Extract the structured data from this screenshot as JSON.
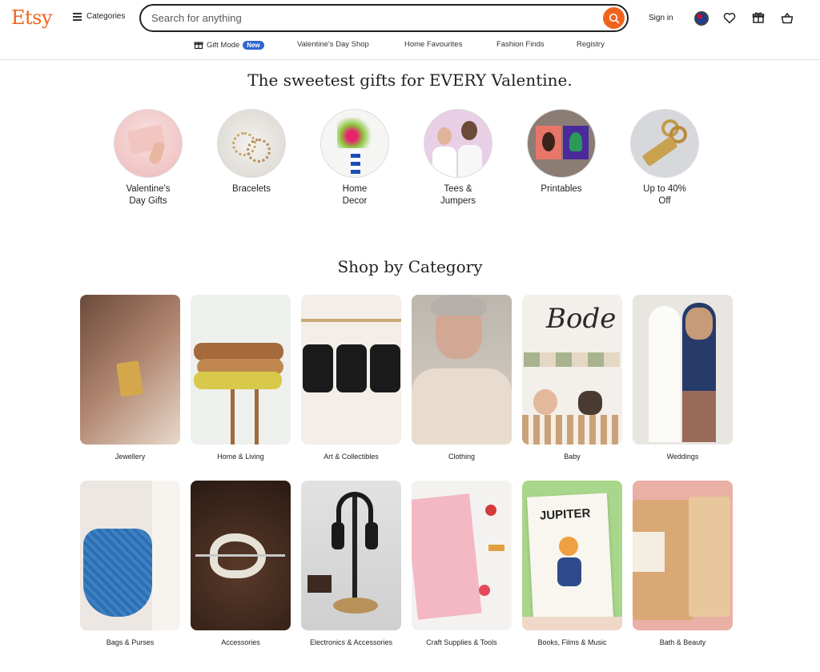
{
  "header": {
    "logo": "Etsy",
    "categories_label": "Categories",
    "search_placeholder": "Search for anything",
    "sign_in": "Sign in",
    "brand_color": "#f1641e"
  },
  "subnav": {
    "items": [
      {
        "label": "Gift Mode",
        "badge": "New",
        "icon": "gift-icon"
      },
      {
        "label": "Valentine's Day Shop"
      },
      {
        "label": "Home Favourites"
      },
      {
        "label": "Fashion Finds"
      },
      {
        "label": "Registry"
      }
    ]
  },
  "hero": {
    "title": "The sweetest gifts for EVERY Valentine.",
    "circles": [
      {
        "label": "Valentine's Day Gifts"
      },
      {
        "label": "Bracelets"
      },
      {
        "label": "Home Decor"
      },
      {
        "label": "Tees & Jumpers"
      },
      {
        "label": "Printables"
      },
      {
        "label": "Up to 40% Off"
      }
    ]
  },
  "shop_by_category": {
    "title": "Shop by Category",
    "tiles": [
      {
        "label": "Jewellery"
      },
      {
        "label": "Home & Living"
      },
      {
        "label": "Art & Collectibles"
      },
      {
        "label": "Clothing"
      },
      {
        "label": "Baby"
      },
      {
        "label": "Weddings"
      },
      {
        "label": "Bags & Purses"
      },
      {
        "label": "Accessories"
      },
      {
        "label": "Electronics & Accessories"
      },
      {
        "label": "Craft Supplies & Tools"
      },
      {
        "label": "Books, Films & Music"
      },
      {
        "label": "Bath & Beauty"
      }
    ]
  }
}
